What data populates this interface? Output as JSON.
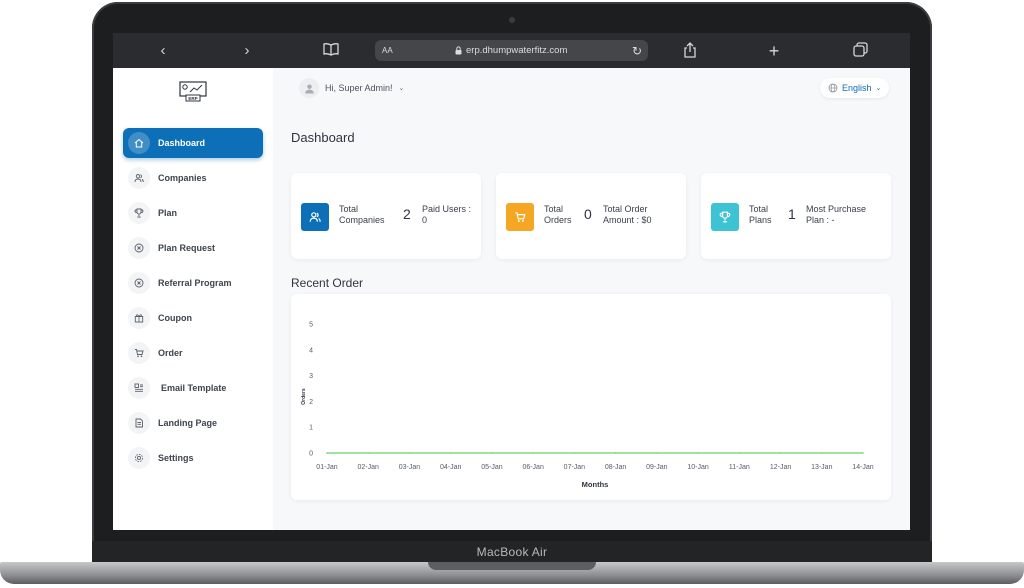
{
  "device": {
    "label": "MacBook Air"
  },
  "browser": {
    "reader_label": "AA",
    "url": "erp.dhumpwaterfitz.com"
  },
  "sidebar": {
    "logo_text": "ERP",
    "items": [
      {
        "label": "Dashboard",
        "icon": "home-icon",
        "active": true
      },
      {
        "label": "Companies",
        "icon": "users-icon"
      },
      {
        "label": "Plan",
        "icon": "trophy-icon"
      },
      {
        "label": "Plan Request",
        "icon": "circle-x-icon"
      },
      {
        "label": "Referral Program",
        "icon": "circle-x-icon"
      },
      {
        "label": "Coupon",
        "icon": "gift-icon"
      },
      {
        "label": "Order",
        "icon": "cart-icon"
      },
      {
        "label": "Email Template",
        "icon": "template-icon"
      },
      {
        "label": "Landing Page",
        "icon": "page-icon"
      },
      {
        "label": "Settings",
        "icon": "gear-icon"
      }
    ]
  },
  "header": {
    "greeting": "Hi, Super Admin!",
    "language": "English"
  },
  "page": {
    "title": "Dashboard"
  },
  "stats": [
    {
      "label": "Total Companies",
      "value": "2",
      "sub": "Paid Users : 0",
      "color": "#0c6fb8",
      "icon": "users-icon"
    },
    {
      "label": "Total Orders",
      "value": "0",
      "sub": "Total Order Amount : $0",
      "color": "#f5a623",
      "icon": "cart-icon"
    },
    {
      "label": "Total Plans",
      "value": "1",
      "sub": "Most Purchase Plan : -",
      "color": "#3ec3d5",
      "icon": "trophy-icon"
    }
  ],
  "recent_order": {
    "title": "Recent Order"
  },
  "chart_data": {
    "type": "line",
    "title": "",
    "xlabel": "Months",
    "ylabel": "Orders",
    "categories": [
      "01-Jan",
      "02-Jan",
      "03-Jan",
      "04-Jan",
      "05-Jan",
      "06-Jan",
      "07-Jan",
      "08-Jan",
      "09-Jan",
      "10-Jan",
      "11-Jan",
      "12-Jan",
      "13-Jan",
      "14-Jan"
    ],
    "yticks": [
      0,
      1,
      2,
      3,
      4,
      5
    ],
    "ylim": [
      0,
      5
    ],
    "grid": false,
    "series": [
      {
        "values": [
          0,
          0,
          0,
          0,
          0,
          0,
          0,
          0,
          0,
          0,
          0,
          0,
          0,
          0
        ],
        "color": "#6ccf6c"
      }
    ]
  }
}
